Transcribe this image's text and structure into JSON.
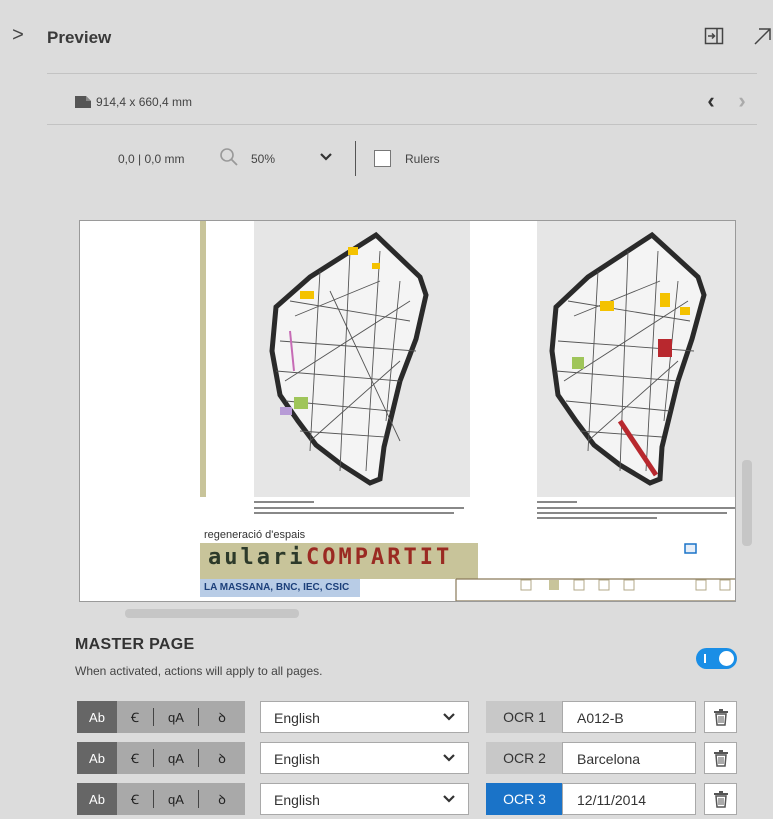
{
  "panel": {
    "title": "Preview",
    "expand_icon": "chevron-right-icon",
    "dock_icon": "dock-icon",
    "popout_icon": "popout-arrow-icon"
  },
  "size_row": {
    "doc_icon": "document-icon",
    "page_size": "914,4 x 660,4 mm",
    "prev_icon": "chevron-left-icon",
    "next_icon": "chevron-right-icon"
  },
  "toolbar": {
    "coordinates": "0,0 | 0,0 mm",
    "zoom_icon": "magnifier-icon",
    "zoom": "50%",
    "rulers_label": "Rulers",
    "rulers_checked": false
  },
  "preview": {
    "subtitle": "regeneració d'espais",
    "headline_left": "aulari",
    "headline_right": "COMPARTIT",
    "credits": "LA MASSANA, BNC, IEC, CSIC",
    "colors": {
      "olive_band": "#c8c49a",
      "map_border": "#2a2a2a",
      "highlight_yellow": "#f4c200",
      "highlight_red": "#b8282e",
      "selection_blue": "#1a73c8"
    }
  },
  "master_page": {
    "title": "MASTER PAGE",
    "description": "When activated, actions will apply to all pages.",
    "enabled": true
  },
  "rows": [
    {
      "format_active": "Ab",
      "language": "English",
      "ocr_label": "OCR 1",
      "ocr_value": "A012-B",
      "active": false
    },
    {
      "format_active": "Ab",
      "language": "English",
      "ocr_label": "OCR 2",
      "ocr_value": "Barcelona",
      "active": false
    },
    {
      "format_active": "Ab",
      "language": "English",
      "ocr_label": "OCR 3",
      "ocr_value": "12/11/2014",
      "active": true
    }
  ],
  "colors": {
    "accent": "#1a73c8",
    "toggle_on": "#1a8ee6",
    "panel_bg": "#dcdcdc"
  }
}
